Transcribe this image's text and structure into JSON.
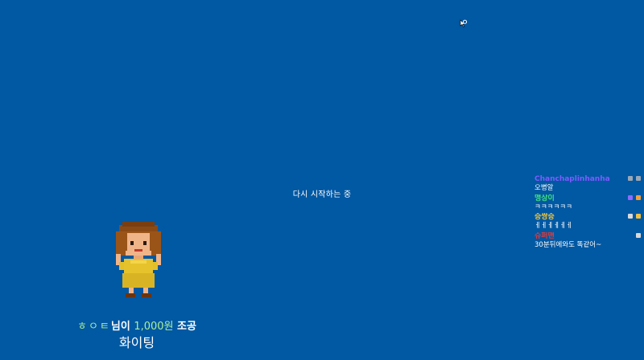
{
  "overlay": {
    "status_text": "다시 시작하는 중"
  },
  "chat": {
    "messages": [
      {
        "name": "Chanchaplinhanha",
        "name_color": "#7c5cff",
        "text": "오병알",
        "badges": [
          "#9aa7b5",
          "#9aa7b5"
        ]
      },
      {
        "name": "맹상이",
        "name_color": "#3fe37a",
        "text": "ㅋㅋㅋㅋㅋㅋ",
        "badges": [
          "#8a6cff",
          "#f0a040"
        ]
      },
      {
        "name": "승쌍승",
        "name_color": "#f0c43a",
        "text": "ㅔㅔㅔㅔㅔㅔ",
        "badges": [
          "#d9d9d9",
          "#f0c040"
        ]
      },
      {
        "name": "슈퍼맨",
        "name_color": "#e23b3b",
        "text": "30분뒤에와도 똑같어~",
        "badges": [
          "#d9d9d9"
        ]
      }
    ]
  },
  "donation": {
    "donor": "ㅎㅇㅌ",
    "suffix_1": "님이 ",
    "amount": "1,000원",
    "suffix_2": " 조공",
    "message": "화이팅"
  },
  "colors": {
    "background": "#0158a3",
    "highlight_green": "#a8f09a"
  },
  "icons": {
    "cursor": "busy-arrow-cursor-icon",
    "character": "pixel-character-avatar"
  }
}
